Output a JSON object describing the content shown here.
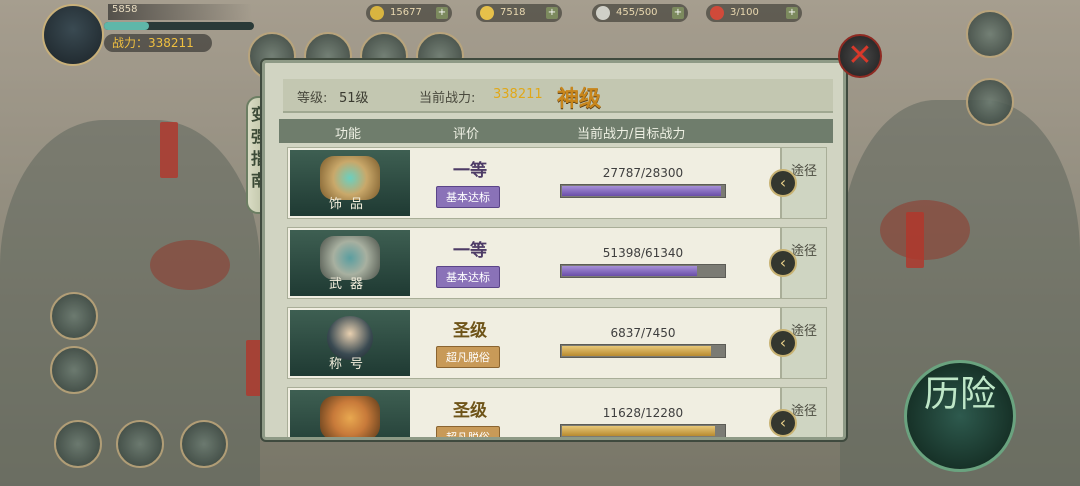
{
  "hud": {
    "player_name": "5858",
    "player_power": "战力：338211",
    "resources": [
      {
        "value": "15677",
        "icon": "gold-ingot-icon",
        "color": "#d8b440"
      },
      {
        "value": "7518",
        "icon": "coin-icon",
        "color": "#e6c04a"
      },
      {
        "value": "455/500",
        "icon": "stamina-icon",
        "color": "#d0d0c8"
      },
      {
        "value": "3/100",
        "icon": "peach-icon",
        "color": "#d04a3a"
      }
    ],
    "adventure_label": "历险"
  },
  "modal": {
    "side_tab_label": "变强指南",
    "level_label": "等级:",
    "level_value": "51级",
    "power_label": "当前战力:",
    "power_value": "338211",
    "grade": "神级",
    "columns": [
      "功能",
      "评价",
      "当前战力/目标战力"
    ],
    "close_icon": "close-icon",
    "rows": [
      {
        "name": "饰品",
        "rating": "一等",
        "badge": "基本达标",
        "tone": "purple",
        "current": 27787,
        "target": 28300,
        "progress_text": "27787/28300",
        "path_label": "途径",
        "art_color": "#c9a86a"
      },
      {
        "name": "武器",
        "rating": "一等",
        "badge": "基本达标",
        "tone": "purple",
        "current": 51398,
        "target": 61340,
        "progress_text": "51398/61340",
        "path_label": "途径",
        "art_color": "#a8b0a0"
      },
      {
        "name": "称号",
        "rating": "圣级",
        "badge": "超凡脱俗",
        "tone": "gold",
        "current": 6837,
        "target": 7450,
        "progress_text": "6837/7450",
        "path_label": "途径",
        "art_color": "#4a6a78"
      },
      {
        "name": "",
        "rating": "圣级",
        "badge": "超凡脱俗",
        "tone": "gold",
        "current": 11628,
        "target": 12280,
        "progress_text": "11628/12280",
        "path_label": "途径",
        "art_color": "#c87a3a"
      }
    ]
  }
}
